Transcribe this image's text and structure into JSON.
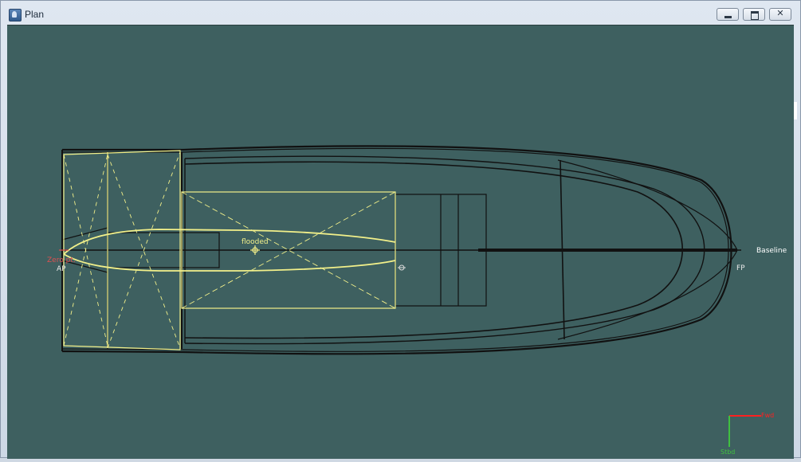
{
  "window": {
    "title": "Plan"
  },
  "labels": {
    "flooded": "flooded",
    "zero_pt": "Zero pt.",
    "ap": "AP",
    "fp": "FP",
    "baseline": "Baseline",
    "axis_fwd": "Fwd",
    "axis_stbd": "Stbd"
  },
  "colors": {
    "background": "#3e6060",
    "hull_lines": "#111111",
    "tank_outline": "#f2f08a",
    "zero_marker": "#e05050",
    "axis_fwd": "#ff2020",
    "axis_stbd": "#40c040"
  }
}
